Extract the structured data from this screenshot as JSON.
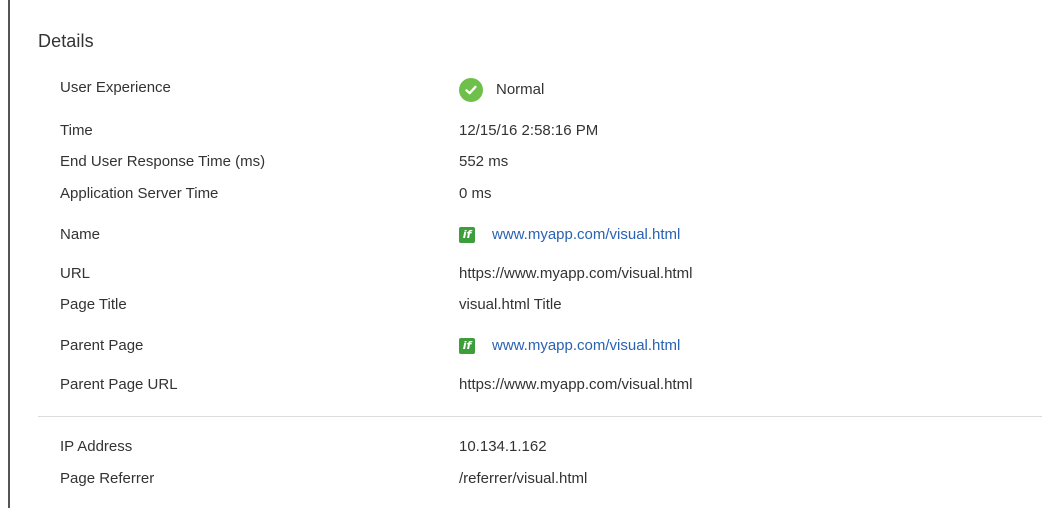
{
  "section": {
    "title": "Details"
  },
  "rows": [
    {
      "label": "User Experience",
      "value": "Normal",
      "icon": "check-circle-icon",
      "icon_color": "#6fc04a"
    },
    {
      "label": "Time",
      "value": "12/15/16 2:58:16 PM"
    },
    {
      "label": "End User Response Time (ms)",
      "value": "552 ms"
    },
    {
      "label": "Application Server Time",
      "value": "0 ms"
    },
    {
      "label": "Name",
      "value": "www.myapp.com/visual.html",
      "icon": "page-type-icon",
      "icon_color": "#3f9e3c"
    },
    {
      "label": "URL",
      "value": "https://www.myapp.com/visual.html"
    },
    {
      "label": "Page Title",
      "value": "visual.html Title"
    },
    {
      "label": "Parent Page",
      "value": "www.myapp.com/visual.html",
      "icon": "page-type-icon",
      "icon_color": "#3f9e3c"
    },
    {
      "label": "Parent Page URL",
      "value": "https://www.myapp.com/visual.html"
    },
    {
      "label": "IP Address",
      "value": "10.134.1.162"
    },
    {
      "label": "Page Referrer",
      "value": "/referrer/visual.html"
    }
  ],
  "colors": {
    "link": "#2a62b3",
    "text": "#333333",
    "divider": "#dcdcdc"
  }
}
